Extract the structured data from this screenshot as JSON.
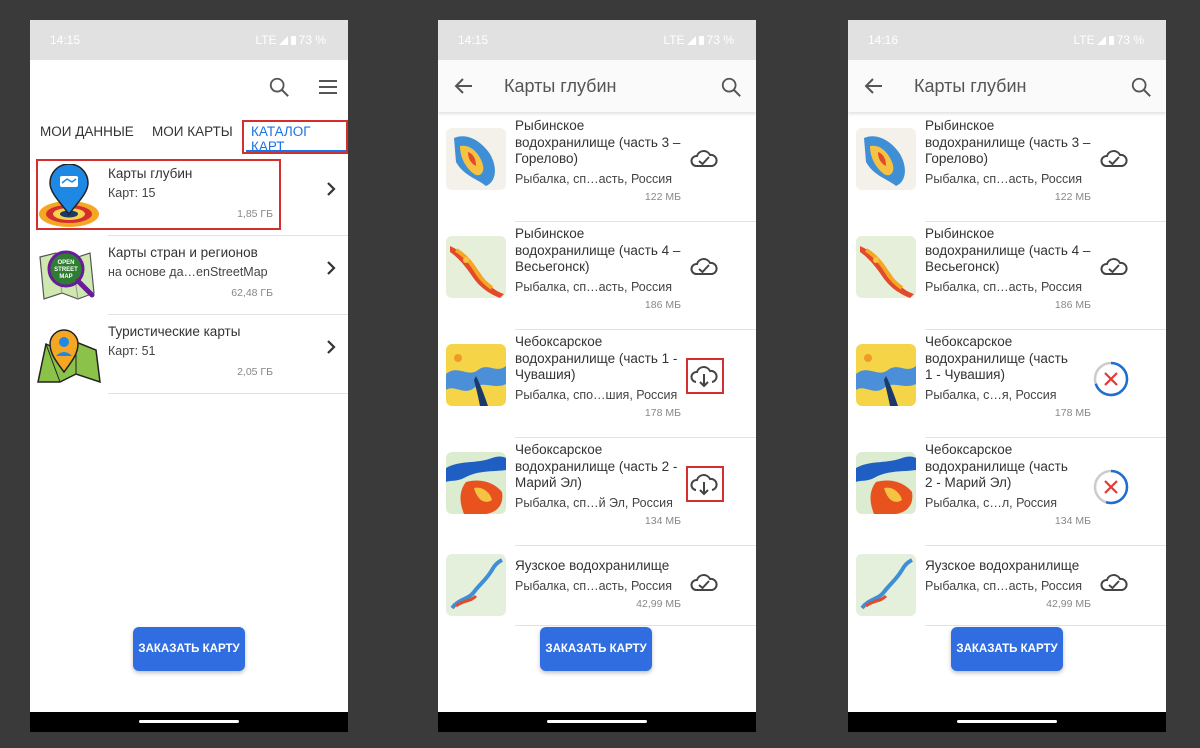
{
  "colors": {
    "accent": "#1a73e8",
    "button": "#2f6de0",
    "highlight": "#d32f2f",
    "cancel": "#e53935"
  },
  "screens": [
    {
      "status": {
        "time": "14:15",
        "net": "LTE",
        "battery": "73 %"
      },
      "tabs": [
        "МОИ ДАННЫЕ",
        "МОИ КАРТЫ",
        "КАТАЛОГ КАРТ"
      ],
      "categories": [
        {
          "name": "Карты глубин",
          "sub": "Карт: 15",
          "size": "1,85 ГБ",
          "icon": "depth-map-pin-icon"
        },
        {
          "name": "Карты стран и регионов",
          "sub": "на основе да…enStreetMap",
          "size": "62,48 ГБ",
          "icon": "openstreetmap-icon",
          "logo_text": "OPEN STREET MAP"
        },
        {
          "name": "Туристические карты",
          "sub": "Карт: 51",
          "size": "2,05 ГБ",
          "icon": "tourist-map-icon"
        }
      ],
      "order_button": "ЗАКАЗАТЬ КАРТУ"
    },
    {
      "status": {
        "time": "14:15",
        "net": "LTE",
        "battery": "73 %"
      },
      "title": "Карты глубин",
      "items": [
        {
          "name": "Рыбинское водохранилище (часть 3 – Горелово)",
          "sub": "Рыбалка, сп…асть, Россия",
          "size": "122 МБ",
          "state": "downloaded"
        },
        {
          "name": "Рыбинское водохранилище (часть 4 – Весьегонск)",
          "sub": "Рыбалка, сп…асть, Россия",
          "size": "186 МБ",
          "state": "downloaded"
        },
        {
          "name": "Чебоксарское водохранилище (часть 1 - Чувашия)",
          "sub": "Рыбалка, спо…шия, Россия",
          "size": "178 МБ",
          "state": "download"
        },
        {
          "name": "Чебоксарское водохранилище (часть 2 - Марий Эл)",
          "sub": "Рыбалка, сп…й Эл, Россия",
          "size": "134 МБ",
          "state": "download"
        },
        {
          "name": "Яузское водохранилище",
          "sub": "Рыбалка, сп…асть, Россия",
          "size": "42,99 МБ",
          "state": "downloaded"
        }
      ],
      "order_button": "ЗАКАЗАТЬ КАРТУ"
    },
    {
      "status": {
        "time": "14:16",
        "net": "LTE",
        "battery": "73 %"
      },
      "title": "Карты глубин",
      "items": [
        {
          "name": "Рыбинское водохранилище (часть 3 – Горелово)",
          "sub": "Рыбалка, сп…асть, Россия",
          "size": "122 МБ",
          "state": "downloaded"
        },
        {
          "name": "Рыбинское водохранилище (часть 4 – Весьегонск)",
          "sub": "Рыбалка, сп…асть, Россия",
          "size": "186 МБ",
          "state": "downloaded"
        },
        {
          "name": "Чебоксарское водохранилище (часть 1 - Чувашия)",
          "sub": "Рыбалка, с…я, Россия",
          "size": "178 МБ",
          "state": "downloading",
          "progress": 0.7
        },
        {
          "name": "Чебоксарское водохранилище (часть 2 - Марий Эл)",
          "sub": "Рыбалка, с…л, Россия",
          "size": "134 МБ",
          "state": "downloading",
          "progress": 0.55
        },
        {
          "name": "Яузское водохранилище",
          "sub": "Рыбалка, сп…асть, Россия",
          "size": "42,99 МБ",
          "state": "downloaded"
        }
      ],
      "order_button": "ЗАКАЗАТЬ КАРТУ"
    }
  ]
}
